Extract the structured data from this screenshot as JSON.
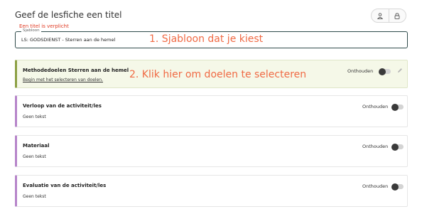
{
  "header": {
    "title": "Geef de lesfiche een titel",
    "error": "Een titel is verplicht",
    "template_label": "Sjabloon",
    "template_value": "LS: GODSDIENST - Sterren aan de hemel"
  },
  "annotations": {
    "step1": "1. Sjabloon dat je kiest",
    "step2": "2. Klik hier om doelen te selecteren"
  },
  "cards": {
    "goals": {
      "title": "Methodedoelen Sterren aan de hemel",
      "link": "Begin met het selecteren van doelen.",
      "remember": "Onthouden"
    },
    "course": {
      "title": "Verloop van de activiteit/les",
      "text": "Geen tekst",
      "remember": "Onthouden"
    },
    "material": {
      "title": "Materiaal",
      "text": "Geen tekst",
      "remember": "Onthouden"
    },
    "evaluation": {
      "title": "Evaluatie van de activiteit/les",
      "text": "Geen tekst",
      "remember": "Onthouden"
    }
  },
  "colors": {
    "annotation": "#f06a44",
    "error": "#e03b24",
    "goals_accent": "#8ca043",
    "section_accent": "#b684c9"
  },
  "icons": [
    "person-icon",
    "lock-icon",
    "pencil-icon"
  ]
}
